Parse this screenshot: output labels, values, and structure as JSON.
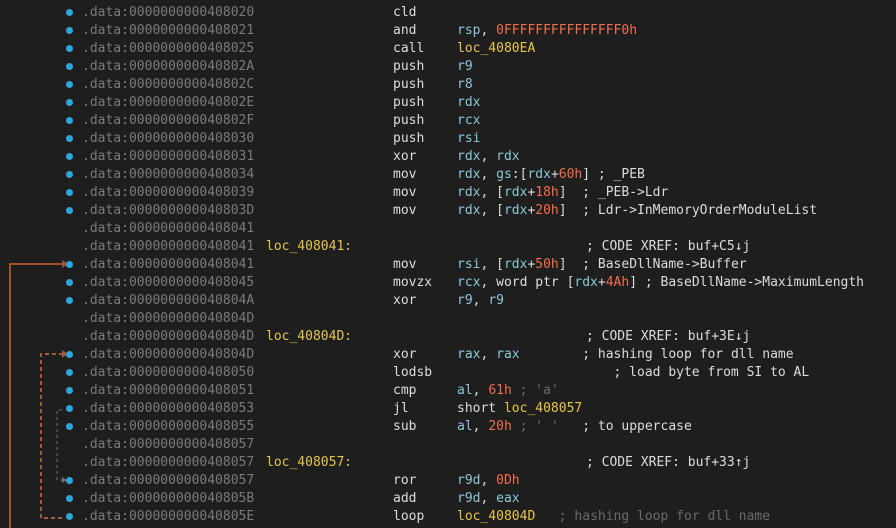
{
  "segment": ".data",
  "colors": {
    "background": "#1e1e1e",
    "address": "#7a7a7a",
    "label": "#e8c547",
    "register": "#8cc8d8",
    "number": "#f36d4f",
    "breakpoint_dot": "#2aa9e0",
    "arrow_solid": "#a0522d",
    "arrow_dashed": "#a05a3c"
  },
  "lines": [
    {
      "addr": "0000000000408020",
      "dot": true,
      "mn": "cld",
      "ops": []
    },
    {
      "addr": "0000000000408021",
      "dot": true,
      "mn": "and",
      "ops": [
        {
          "t": "rsp",
          "c": "reg"
        },
        {
          "t": ", ",
          "c": "wht"
        },
        {
          "t": "0FFFFFFFFFFFFFFF0h",
          "c": "num"
        }
      ]
    },
    {
      "addr": "0000000000408025",
      "dot": true,
      "mn": "call",
      "ops": [
        {
          "t": "loc_4080EA",
          "c": "sym"
        }
      ]
    },
    {
      "addr": "000000000040802A",
      "dot": true,
      "mn": "push",
      "ops": [
        {
          "t": "r9",
          "c": "reg"
        }
      ]
    },
    {
      "addr": "000000000040802C",
      "dot": true,
      "mn": "push",
      "ops": [
        {
          "t": "r8",
          "c": "reg"
        }
      ]
    },
    {
      "addr": "000000000040802E",
      "dot": true,
      "mn": "push",
      "ops": [
        {
          "t": "rdx",
          "c": "reg"
        }
      ]
    },
    {
      "addr": "000000000040802F",
      "dot": true,
      "mn": "push",
      "ops": [
        {
          "t": "rcx",
          "c": "reg"
        }
      ]
    },
    {
      "addr": "0000000000408030",
      "dot": true,
      "mn": "push",
      "ops": [
        {
          "t": "rsi",
          "c": "reg"
        }
      ]
    },
    {
      "addr": "0000000000408031",
      "dot": true,
      "mn": "xor",
      "ops": [
        {
          "t": "rdx",
          "c": "reg"
        },
        {
          "t": ", ",
          "c": "wht"
        },
        {
          "t": "rdx",
          "c": "reg"
        }
      ]
    },
    {
      "addr": "0000000000408034",
      "dot": true,
      "mn": "mov",
      "ops": [
        {
          "t": "rdx",
          "c": "reg"
        },
        {
          "t": ", ",
          "c": "wht"
        },
        {
          "t": "gs",
          "c": "reg"
        },
        {
          "t": ":[",
          "c": "wht"
        },
        {
          "t": "rdx",
          "c": "reg"
        },
        {
          "t": "+",
          "c": "wht"
        },
        {
          "t": "60h",
          "c": "num"
        },
        {
          "t": "] ; _PEB",
          "c": "wht"
        }
      ]
    },
    {
      "addr": "0000000000408039",
      "dot": true,
      "mn": "mov",
      "ops": [
        {
          "t": "rdx",
          "c": "reg"
        },
        {
          "t": ", [",
          "c": "wht"
        },
        {
          "t": "rdx",
          "c": "reg"
        },
        {
          "t": "+",
          "c": "wht"
        },
        {
          "t": "18h",
          "c": "num"
        },
        {
          "t": "]  ; _PEB->Ldr",
          "c": "wht"
        }
      ]
    },
    {
      "addr": "000000000040803D",
      "dot": true,
      "mn": "mov",
      "ops": [
        {
          "t": "rdx",
          "c": "reg"
        },
        {
          "t": ", [",
          "c": "wht"
        },
        {
          "t": "rdx",
          "c": "reg"
        },
        {
          "t": "+",
          "c": "wht"
        },
        {
          "t": "20h",
          "c": "num"
        },
        {
          "t": "]  ; Ldr->InMemoryOrderModuleList",
          "c": "wht"
        }
      ]
    },
    {
      "addr": "0000000000408041",
      "dot": false,
      "mn": "",
      "ops": []
    },
    {
      "addr": "0000000000408041",
      "dot": false,
      "label": "loc_408041:",
      "xref": "; CODE XREF: buf+C5↓j",
      "mn": "",
      "ops": []
    },
    {
      "addr": "0000000000408041",
      "dot": true,
      "mn": "mov",
      "ops": [
        {
          "t": "rsi",
          "c": "reg"
        },
        {
          "t": ", [",
          "c": "wht"
        },
        {
          "t": "rdx",
          "c": "reg"
        },
        {
          "t": "+",
          "c": "wht"
        },
        {
          "t": "50h",
          "c": "num"
        },
        {
          "t": "]  ; BaseDllName->Buffer",
          "c": "wht"
        }
      ]
    },
    {
      "addr": "0000000000408045",
      "dot": true,
      "mn": "movzx",
      "ops": [
        {
          "t": "rcx",
          "c": "reg"
        },
        {
          "t": ", word ptr [",
          "c": "wht"
        },
        {
          "t": "rdx",
          "c": "reg"
        },
        {
          "t": "+",
          "c": "wht"
        },
        {
          "t": "4Ah",
          "c": "num"
        },
        {
          "t": "] ; BaseDllName->MaximumLength",
          "c": "wht"
        }
      ]
    },
    {
      "addr": "000000000040804A",
      "dot": true,
      "mn": "xor",
      "ops": [
        {
          "t": "r9",
          "c": "reg"
        },
        {
          "t": ", ",
          "c": "wht"
        },
        {
          "t": "r9",
          "c": "reg"
        }
      ]
    },
    {
      "addr": "000000000040804D",
      "dot": false,
      "mn": "",
      "ops": []
    },
    {
      "addr": "000000000040804D",
      "dot": false,
      "label": "loc_40804D:",
      "xref": "; CODE XREF: buf+3E↓j",
      "mn": "",
      "ops": []
    },
    {
      "addr": "000000000040804D",
      "dot": true,
      "mn": "xor",
      "ops": [
        {
          "t": "rax",
          "c": "reg"
        },
        {
          "t": ", ",
          "c": "wht"
        },
        {
          "t": "rax",
          "c": "reg"
        },
        {
          "t": "        ; hashing loop for dll name",
          "c": "wht"
        }
      ]
    },
    {
      "addr": "0000000000408050",
      "dot": true,
      "mn": "lodsb",
      "ops": [
        {
          "t": "                    ; load byte from SI to AL",
          "c": "wht"
        }
      ]
    },
    {
      "addr": "0000000000408051",
      "dot": true,
      "mn": "cmp",
      "ops": [
        {
          "t": "al",
          "c": "reg"
        },
        {
          "t": ", ",
          "c": "wht"
        },
        {
          "t": "61h",
          "c": "num"
        },
        {
          "t": " ; 'a'",
          "c": "dim"
        }
      ]
    },
    {
      "addr": "0000000000408053",
      "dot": true,
      "mn": "jl",
      "ops": [
        {
          "t": "short ",
          "c": "wht"
        },
        {
          "t": "loc_408057",
          "c": "sym"
        }
      ]
    },
    {
      "addr": "0000000000408055",
      "dot": true,
      "mn": "sub",
      "ops": [
        {
          "t": "al",
          "c": "reg"
        },
        {
          "t": ", ",
          "c": "wht"
        },
        {
          "t": "20h",
          "c": "num"
        },
        {
          "t": " ; ' '",
          "c": "dim"
        },
        {
          "t": "   ; to uppercase",
          "c": "wht"
        }
      ]
    },
    {
      "addr": "0000000000408057",
      "dot": false,
      "mn": "",
      "ops": []
    },
    {
      "addr": "0000000000408057",
      "dot": false,
      "label": "loc_408057:",
      "xref": "; CODE XREF: buf+33↑j",
      "mn": "",
      "ops": []
    },
    {
      "addr": "0000000000408057",
      "dot": true,
      "mn": "ror",
      "ops": [
        {
          "t": "r9d",
          "c": "reg"
        },
        {
          "t": ", ",
          "c": "wht"
        },
        {
          "t": "0Dh",
          "c": "num"
        }
      ]
    },
    {
      "addr": "000000000040805B",
      "dot": true,
      "mn": "add",
      "ops": [
        {
          "t": "r9d",
          "c": "reg"
        },
        {
          "t": ", ",
          "c": "wht"
        },
        {
          "t": "eax",
          "c": "reg"
        }
      ]
    },
    {
      "addr": "000000000040805E",
      "dot": true,
      "mn": "loop",
      "ops": [
        {
          "t": "loc_40804D",
          "c": "sym"
        },
        {
          "t": "   ; hashing loop for dll name",
          "c": "dim"
        }
      ]
    }
  ]
}
